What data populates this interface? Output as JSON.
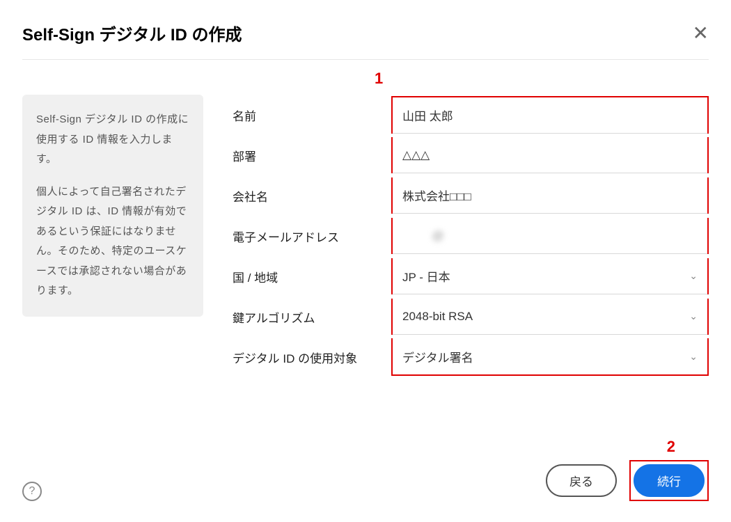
{
  "dialog": {
    "title": "Self-Sign デジタル ID の作成"
  },
  "info": {
    "paragraph1": "Self-Sign デジタル ID の作成に使用する ID 情報を入力します。",
    "paragraph2": "個人によって自己署名されたデジタル ID は、ID 情報が有効であるという保証にはなりません。そのため、特定のユースケースでは承認されない場合があります。"
  },
  "annotations": {
    "marker1": "1",
    "marker2": "2"
  },
  "form": {
    "name": {
      "label": "名前",
      "value": "山田 太郎"
    },
    "department": {
      "label": "部署",
      "value": "△△△"
    },
    "company": {
      "label": "会社名",
      "value": "株式会社□□□"
    },
    "email": {
      "label": "電子メールアドレス",
      "value": "         @"
    },
    "country": {
      "label": "国 / 地域",
      "value": "JP - 日本"
    },
    "algorithm": {
      "label": "鍵アルゴリズム",
      "value": "2048-bit RSA"
    },
    "usage": {
      "label": "デジタル ID の使用対象",
      "value": "デジタル署名"
    }
  },
  "footer": {
    "back": "戻る",
    "continue": "続行"
  }
}
